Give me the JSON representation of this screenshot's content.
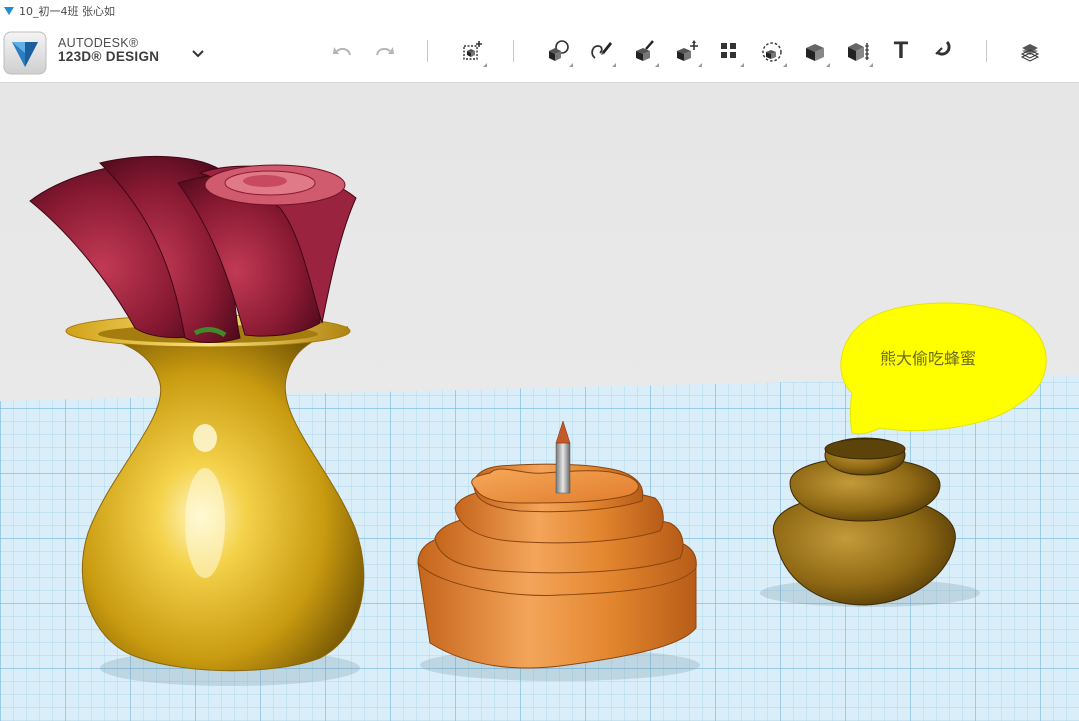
{
  "window": {
    "title": "10_初一4班 张心如"
  },
  "app": {
    "brand_line1": "AUTODESK®",
    "brand_line2": "123D® DESIGN"
  },
  "toolbar": {
    "undo_icon": "undo-icon",
    "redo_icon": "redo-icon",
    "tools": [
      "transform-icon",
      "primitives-icon",
      "sketch-icon",
      "construct-icon",
      "modify-icon",
      "pattern-icon",
      "group-icon",
      "combine-icon",
      "measure-icon",
      "text-icon",
      "snap-icon",
      "material-icon"
    ],
    "text_tool_label": "T"
  },
  "viewport": {
    "speech_bubble_text": "熊大偷吃蜂蜜",
    "background_color": "#e9e9e9",
    "grid_color": "#8fc9e6",
    "vase_color": "#d9a916",
    "rose_color": "#8c1b34",
    "cake_color": "#e08a32",
    "pot_color": "#8a6512",
    "bubble_color": "#ffff00"
  }
}
